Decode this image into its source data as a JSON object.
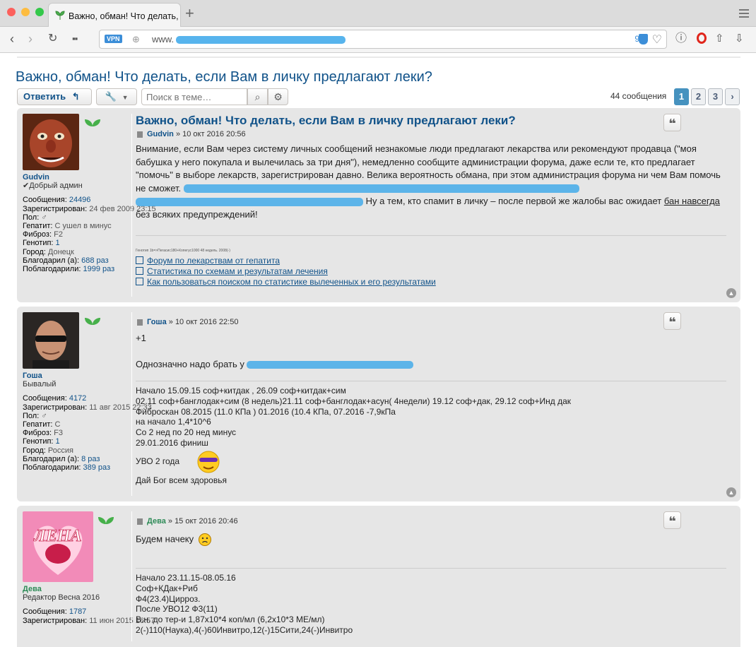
{
  "browser": {
    "tab_title": "Важно, обман! Что делать, е",
    "url_prefix": "www.",
    "ad_block_count": "9",
    "new_tab": "+"
  },
  "topic": {
    "title": "Важно, обман! Что делать, если Вам в личку предлагают леки?",
    "reply_label": "Ответить",
    "search_placeholder": "Поиск в теме…",
    "post_count": "44 сообщения",
    "pages": [
      "1",
      "2",
      "3"
    ],
    "next": "›"
  },
  "posts": [
    {
      "author": "Gudvin",
      "rank": "✔Добрый админ",
      "stats": [
        {
          "k": "Сообщения:",
          "v": "24496",
          "link": true
        },
        {
          "k": "Зарегистрирован:",
          "v": "24 фев 2009 23:15",
          "link": false
        },
        {
          "k": "Пол:",
          "v": "♂",
          "link": false
        },
        {
          "k": "Гепатит:",
          "v": "С ушел в минус",
          "link": false
        },
        {
          "k": "Фиброз:",
          "v": "F2",
          "link": false
        },
        {
          "k": "Генотип:",
          "v": "1",
          "link": false
        },
        {
          "k": "Город:",
          "v": "Донецк",
          "link": false
        },
        {
          "k": "Благодарил (а):",
          "v": "688 раз",
          "link": true
        },
        {
          "k": "Поблагодарили:",
          "v": "1999 раз",
          "link": true
        }
      ],
      "title": "Важно, обман! Что делать, если Вам в личку предлагают леки?",
      "date": "» 10 окт 2016 20:56",
      "text_1": "Внимание, если Вам через систему личных сообщений незнакомые люди предлагают лекарства или рекомендуют продавца (\"моя бабушка у него покупала и вылечилась за три дня\"), немедленно сообщите администрации форума, даже если те, кто предлагает \"помочь\" в выборе лекарств, зарегистрирован давно. Велика вероятность обмана, при этом администрация форума ни чем Вам помочь не сможет.",
      "text_2": "Ну а тем, кто спамит в личку – после первой же жалобы вас ожидает",
      "ban_link": "бан навсегда",
      "text_3": "без всяких предупреждений!",
      "sig_small": "Генотип 1b=>Пегасис180+Копегус1000 48 недель. 2008(-)",
      "sig_links": [
        "Форум по лекарствам от гепатита",
        "Статистика по схемам и результатам лечения",
        "Как пользоваться поиском по статистике вылеченных и его результатами"
      ]
    },
    {
      "author": "Гоша",
      "rank": "Бывалый",
      "stats": [
        {
          "k": "Сообщения:",
          "v": "4172",
          "link": true
        },
        {
          "k": "Зарегистрирован:",
          "v": "11 авг 2015 22:33",
          "link": false
        },
        {
          "k": "Пол:",
          "v": "♂",
          "link": false
        },
        {
          "k": "Гепатит:",
          "v": "С",
          "link": false
        },
        {
          "k": "Фиброз:",
          "v": "F3",
          "link": false
        },
        {
          "k": "Генотип:",
          "v": "1",
          "link": false
        },
        {
          "k": "Город:",
          "v": "Россия",
          "link": false
        },
        {
          "k": "Благодарил (а):",
          "v": "8 раз",
          "link": true
        },
        {
          "k": "Поблагодарили:",
          "v": "389 раз",
          "link": true
        }
      ],
      "date": "» 10 окт 2016 22:50",
      "line_1": "+1",
      "line_2": "Однозначно надо брать у",
      "sig_lines": [
        "Начало 15.09.15 соф+китдак , 26.09 соф+китдак+сим",
        "02.11 соф+банглодак+сим (8 недель)21.11 соф+банглодак+асун( 4недели) 19.12 соф+дак, 29.12 соф+Инд дак",
        "Фиброскан 08.2015 (11.0 КПа ) 01.2016 (10.4 КПа, 07.2016 -7,9кПа",
        "на начало 1,4*10^6",
        "Со 2 нед по 20 нед минус",
        "29.01.2016 финиш"
      ],
      "uvo": "УВО 2 года",
      "bless": "Дай Бог всем здоровья"
    },
    {
      "author": "Дева",
      "rank": "Редактор Весна 2016",
      "avatar_text": "ЛЕНА",
      "stats": [
        {
          "k": "Сообщения:",
          "v": "1787",
          "link": true
        },
        {
          "k": "Зарегистрирован:",
          "v": "11 июн 2015 16:57",
          "link": false
        }
      ],
      "date": "» 15 окт 2016 20:46",
      "line_1": "Будем начеку",
      "sig_lines": [
        "Начало 23.11.15-08.05.16",
        "Соф+КДак+Риб",
        "Ф4(23.4)Цирроз.",
        "После УВО12 Ф3(11)",
        "В.н. до тер-и 1,87х10*4 коп/мл (6,2х10*3 МЕ/мл)",
        "2(-)110(Наука),4(-)60Инвитро,12(-)15Сити,24(-)Инвитро"
      ]
    }
  ],
  "colors": {
    "link": "#105289",
    "post_bg": "#e6e6e6",
    "page_active": "#4692bf",
    "reply_red": "#d31141",
    "gudvin_green": "#105289",
    "deva_green": "#2e8b57"
  }
}
